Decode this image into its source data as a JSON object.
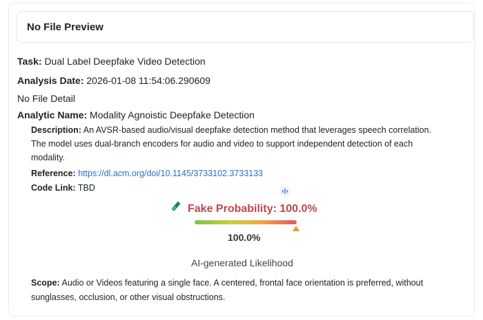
{
  "preview": {
    "title": "No File Preview"
  },
  "task": {
    "label": "Task:",
    "value": "Dual Label Deepfake Video Detection"
  },
  "analysis_date": {
    "label": "Analysis Date:",
    "value": "2026-01-08 11:54:06.290609"
  },
  "file_detail": {
    "text": "No File Detail"
  },
  "analytic": {
    "label": "Analytic Name:",
    "value": "Modality Agnoistic Deepfake Detection",
    "description_label": "Description:",
    "description": "An AVSR-based audio/visual deepfake detection method that leverages speech correlation. The model uses dual-branch encoders for audio and video to support independent detection of each modality.",
    "reference_label": "Reference:",
    "reference_url": "https://dl.acm.org/doi/10.1145/3733102.3733133",
    "code_label": "Code Link:",
    "code_value": "TBD"
  },
  "result": {
    "probability_label": "Fake Probability: 100.0%",
    "probability_fraction": 1.0,
    "percent_text": "100.0%",
    "caption": "AI-generated Likelihood",
    "accent_color": "#c0464f",
    "icons": {
      "modality": "microphone-icon",
      "probability": "test-tube-icon"
    }
  },
  "scope": {
    "label": "Scope:",
    "value": "Audio or Videos featuring a single face. A centered, frontal face orientation is preferred, without sunglasses, occlusion, or other visual obstructions."
  }
}
